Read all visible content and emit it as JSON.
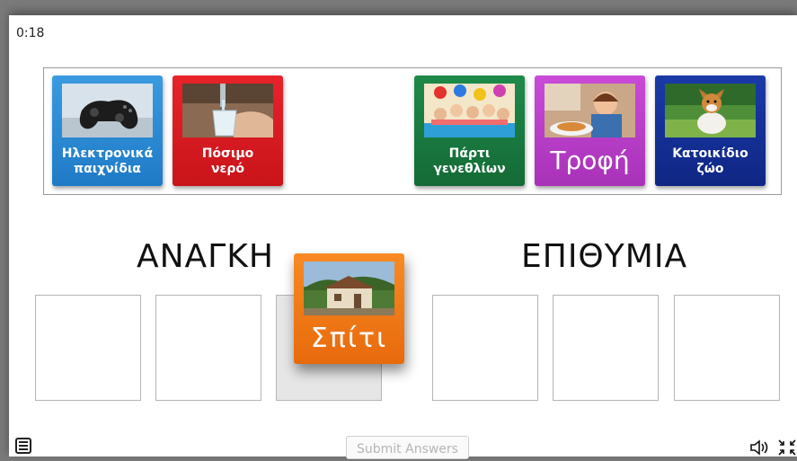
{
  "timer": "0:18",
  "cards": [
    {
      "label": "Ηλεκτρονικά\nπαιχνίδια",
      "icon": "gamepad-photo",
      "color": "#1f7ac6"
    },
    {
      "label": "Πόσιμο\nνερό",
      "icon": "water-glass-photo",
      "color": "#d01a20"
    },
    {
      "label": "Πάρτι\nγενεθλίων",
      "icon": "birthday-party-photo",
      "color": "#17783f"
    },
    {
      "label": "Τροφή",
      "icon": "child-eating-photo",
      "color": "#b83ec8"
    },
    {
      "label": "Κατοικίδιο\nζώο",
      "icon": "dog-photo",
      "color": "#142f96"
    }
  ],
  "categories": {
    "need": "ΑΝΑΓΚΗ",
    "want": "ΕΠΙΘΥΜΙΑ"
  },
  "dragged_card": {
    "label": "Σπίτι",
    "icon": "house-photo",
    "color": "#f07a18"
  },
  "footer": {
    "submit_label": "Submit Answers",
    "menu_icon": "menu-icon",
    "sound_icon": "speaker-icon",
    "fullscreen_icon": "exit-fullscreen-icon"
  }
}
